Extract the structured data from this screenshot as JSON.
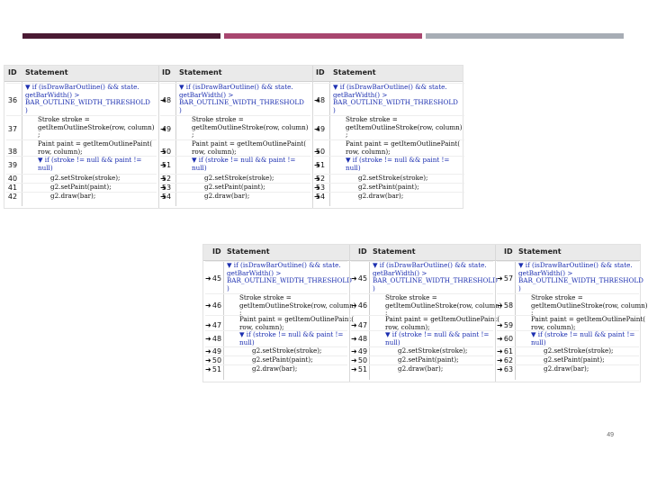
{
  "colors": {
    "bar1": "#4a1a33",
    "bar2": "#a8466f",
    "bar3": "#a7adb5",
    "statement_blue": "#1c2fb0"
  },
  "header": {
    "id": "ID",
    "statement": "Statement"
  },
  "statements": [
    "▼ if (isDrawBarOutline() && state.\ngetBarWidth() >\nBAR_OUTLINE_WIDTH_THRESHOLD\n)",
    "Stroke stroke =\ngetItemOutlineStroke(row, column)\n;",
    "Paint paint = getItemOutlinePaint(\nrow, column);",
    "▼ if (stroke != null && paint !=\nnull)",
    "g2.setStroke(stroke);",
    "g2.setPaint(paint);",
    "g2.draw(bar);"
  ],
  "top_panel": {
    "columns": [
      {
        "ids": [
          "36",
          "37",
          "38",
          "39",
          "40",
          "41",
          "42"
        ],
        "arrows": [
          false,
          false,
          false,
          false,
          false,
          false,
          false
        ]
      },
      {
        "ids": [
          "48",
          "49",
          "50",
          "51",
          "52",
          "53",
          "54"
        ],
        "arrows": [
          true,
          true,
          true,
          true,
          true,
          true,
          true
        ]
      },
      {
        "ids": [
          "48",
          "49",
          "50",
          "51",
          "52",
          "53",
          "54"
        ],
        "arrows": [
          true,
          true,
          true,
          true,
          true,
          true,
          true
        ]
      }
    ]
  },
  "bottom_panel": {
    "columns": [
      {
        "ids": [
          "45",
          "46",
          "47",
          "48",
          "49",
          "50",
          "51"
        ],
        "arrows": [
          true,
          true,
          true,
          true,
          true,
          true,
          true
        ]
      },
      {
        "ids": [
          "45",
          "46",
          "47",
          "48",
          "49",
          "50",
          "51"
        ],
        "arrows": [
          true,
          true,
          true,
          true,
          true,
          true,
          true
        ]
      },
      {
        "ids": [
          "57",
          "58",
          "59",
          "60",
          "61",
          "62",
          "63"
        ],
        "arrows": [
          true,
          true,
          true,
          true,
          true,
          true,
          true
        ]
      }
    ]
  },
  "page_number": "49"
}
